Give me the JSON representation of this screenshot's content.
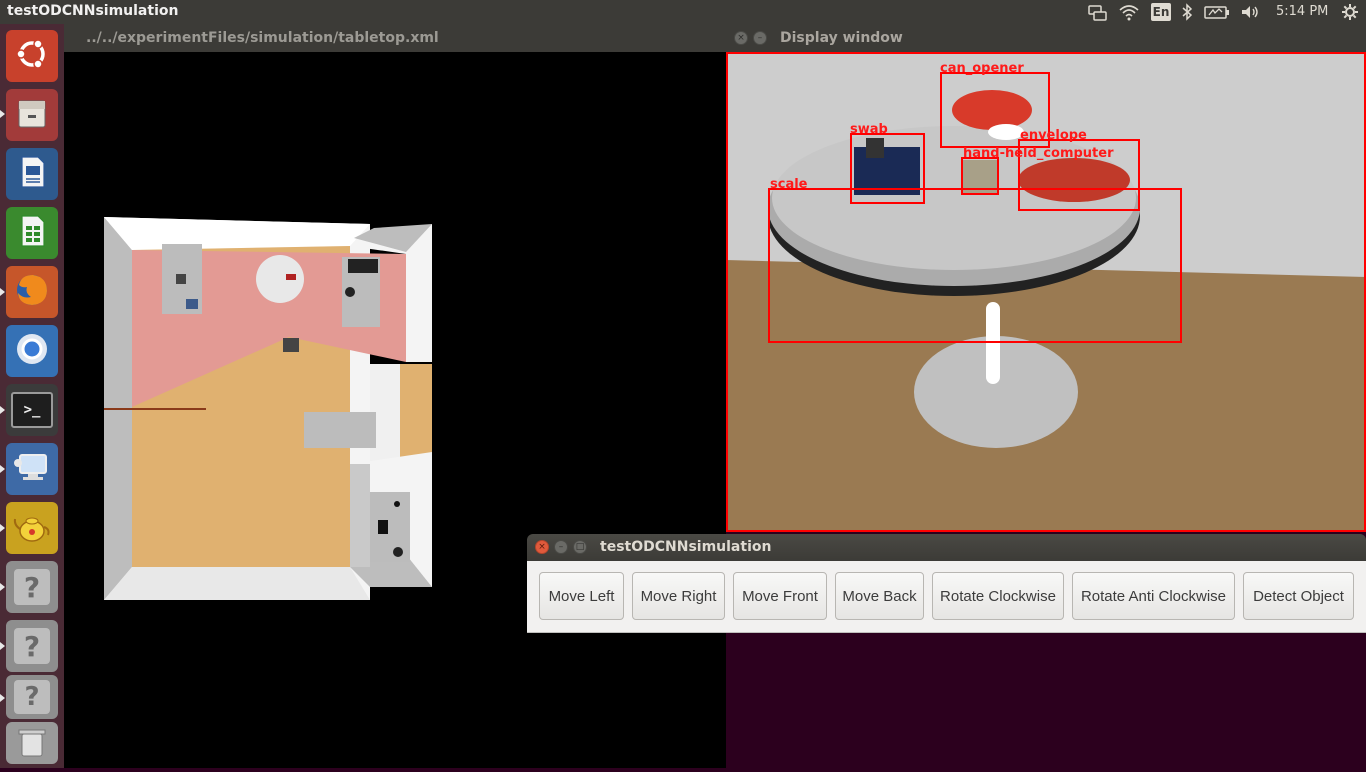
{
  "topbar": {
    "app_title": "testODCNNsimulation",
    "keyboard_layout": "En",
    "clock": "5:14 PM",
    "icons": [
      "network-bridge-icon",
      "wifi-icon",
      "keyboard-layout-indicator",
      "bluetooth-icon",
      "battery-icon",
      "volume-icon",
      "settings-gear-icon"
    ]
  },
  "launcher": {
    "items": [
      {
        "name": "ubuntu-dash",
        "icon": "ubuntu-logo-icon"
      },
      {
        "name": "files",
        "icon": "file-cabinet-icon"
      },
      {
        "name": "libreoffice-writer",
        "icon": "writer-document-icon"
      },
      {
        "name": "libreoffice-calc",
        "icon": "calc-spreadsheet-icon"
      },
      {
        "name": "firefox",
        "icon": "firefox-icon"
      },
      {
        "name": "chromium",
        "icon": "chromium-icon"
      },
      {
        "name": "terminal",
        "icon": "terminal-icon"
      },
      {
        "name": "remote-desktop",
        "icon": "remote-desktop-icon"
      },
      {
        "name": "teapot-app",
        "icon": "teapot-icon"
      },
      {
        "name": "unknown-app-1",
        "icon": "question-mark-icon"
      },
      {
        "name": "unknown-app-2",
        "icon": "question-mark-icon"
      },
      {
        "name": "unknown-app-3",
        "icon": "question-mark-icon"
      },
      {
        "name": "trash",
        "icon": "trash-icon"
      }
    ],
    "terminal_glyph": ">_",
    "question_glyph": "?"
  },
  "simulation_window": {
    "title": "../../experimentFiles/simulation/tabletop.xml"
  },
  "display_window": {
    "title": "Display window",
    "detections": [
      "can_opener",
      "swab",
      "envelope",
      "hand-held_computer",
      "scale"
    ]
  },
  "control_window": {
    "title": "testODCNNsimulation",
    "buttons": [
      "Move Left",
      "Move Right",
      "Move Front",
      "Move Back",
      "Rotate Clockwise",
      "Rotate Anti Clockwise",
      "Detect Object"
    ]
  },
  "colors": {
    "panel": "#3c3b37",
    "launcher": "#4a2a35",
    "desktop": "#2c001e",
    "detection": "#ff0000"
  }
}
